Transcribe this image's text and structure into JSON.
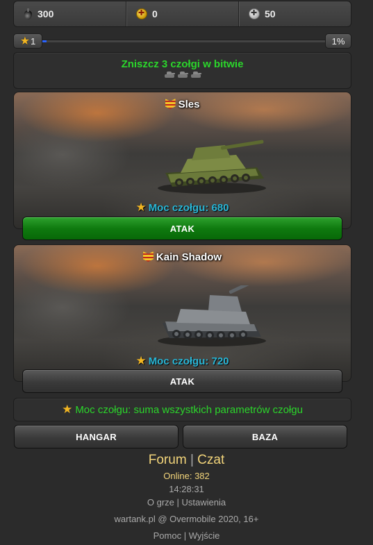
{
  "resources": {
    "fuel": {
      "value": "300",
      "icon": "fuel-drop-icon"
    },
    "gold": {
      "value": "0",
      "icon": "gold-coin-icon"
    },
    "silver": {
      "value": "50",
      "icon": "silver-coin-icon"
    }
  },
  "xp": {
    "level": "1",
    "percent_label": "1%",
    "progress": 0.01,
    "fill_color": "#2a64ff"
  },
  "mission": {
    "text": "Zniszcz 3 czołgi w bitwie",
    "tanks_required": 3
  },
  "opponents": [
    {
      "name": "Sles",
      "power": "Moc czołgu: 680",
      "button": "ATAK",
      "button_style": "green"
    },
    {
      "name": "Kain Shadow",
      "power": "Moc czołgu: 720",
      "button": "ATAK",
      "button_style": "grey"
    }
  ],
  "info": {
    "text": "Moc czołgu: suma wszystkich parametrów czołgu"
  },
  "nav": {
    "hangar": "HANGAR",
    "baza": "BAZA"
  },
  "footer": {
    "forum": "Forum",
    "link_sep": "|",
    "chat": "Czat",
    "online_label": "Online:",
    "online_count": "382",
    "time": "14:28:31",
    "about": "O grze",
    "settings": "Ustawienia",
    "copyright": "wartank.pl @ Overmobile 2020, 16+",
    "help": "Pomoc",
    "logout": "Wyjście"
  },
  "colors": {
    "accent_green": "#2bd62b",
    "power_blue": "#29b6d6",
    "link_gold": "#f2d47a"
  }
}
